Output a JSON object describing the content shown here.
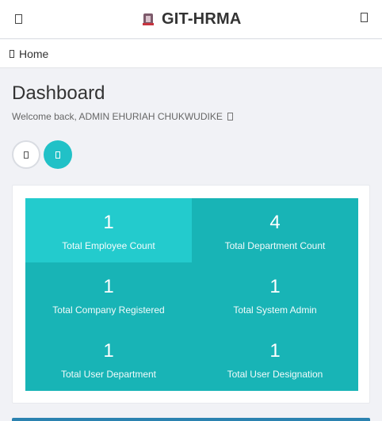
{
  "header": {
    "title": "GIT-HRMA",
    "menu_icon": "",
    "user_icon": ""
  },
  "breadcrumb": {
    "home_icon": "",
    "label": "Home"
  },
  "dashboard": {
    "title": "Dashboard",
    "welcome": "Welcome back, ADMIN EHURIAH CHUKWUDIKE",
    "welcome_icon": ""
  },
  "stats": [
    {
      "value": "1",
      "label": "Total Employee Count"
    },
    {
      "value": "4",
      "label": "Total Department Count"
    },
    {
      "value": "1",
      "label": "Total Company Registered"
    },
    {
      "value": "1",
      "label": "Total System Admin"
    },
    {
      "value": "1",
      "label": "Total User Department"
    },
    {
      "value": "1",
      "label": "Total User Designation"
    }
  ],
  "colors": {
    "accent": "#21c1c7",
    "stat_bg": "#18b4b6",
    "stat_active": "#23cbcd",
    "bottom_bar": "#2b82b0"
  }
}
